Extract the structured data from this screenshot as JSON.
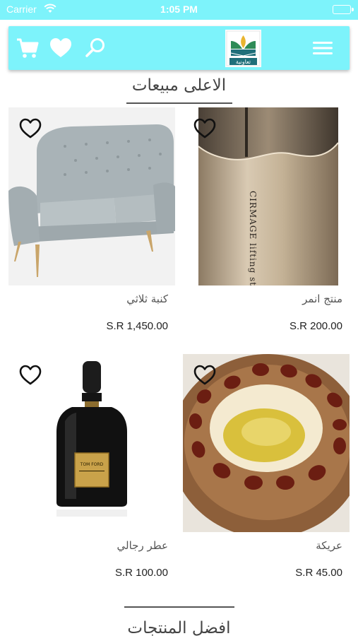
{
  "status_bar": {
    "carrier": "Carrier",
    "time": "1:05 PM",
    "battery_level": 1.0
  },
  "header": {
    "brand_color": "#7df3fb",
    "icons": [
      "cart-icon",
      "heart-icon",
      "search-icon",
      "logo",
      "menu-icon"
    ],
    "logo_text": "تعاونية"
  },
  "best_sellers": {
    "title": "الاعلى مبيعات",
    "products": [
      {
        "name": "كنبة ثلاثي",
        "price": "S.R 1,450.00",
        "image": "sofa"
      },
      {
        "name": "منتج انمر",
        "price": "S.R 200.00",
        "image": "cosmetic-stick",
        "image_text": "CIRMAGE lifting stick"
      },
      {
        "name": "عطر رجالي",
        "price": "S.R 100.00",
        "image": "perfume-bottle",
        "image_text": "TOM FORD"
      },
      {
        "name": "عريكة",
        "price": "S.R 45.00",
        "image": "dessert-dish"
      }
    ]
  },
  "best_products": {
    "title": "افضل المنتجات"
  }
}
